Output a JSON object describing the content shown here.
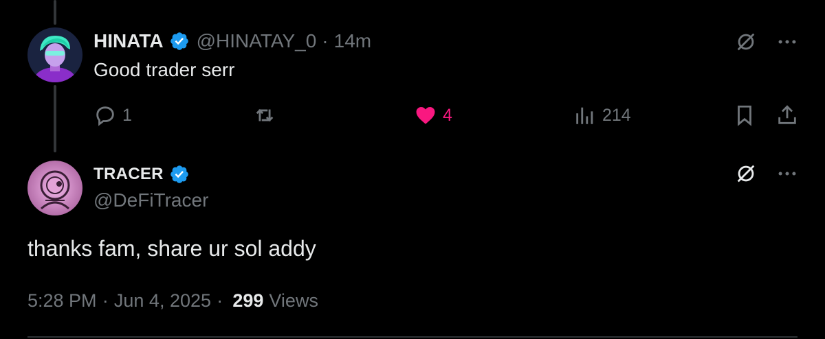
{
  "reply": {
    "author_name": "HINATA",
    "author_handle": "@HINATAY_0",
    "separator": "·",
    "time": "14m",
    "text": "Good trader serr",
    "replies": "1",
    "likes": "4",
    "views": "214",
    "liked": true,
    "like_color": "#f91880"
  },
  "main": {
    "author_name": "TRACER",
    "author_handle": "@DeFiTracer",
    "text": "thanks fam, share ur sol addy",
    "time": "5:28 PM",
    "separator": "·",
    "date": "Jun 4, 2025",
    "views_count": "299",
    "views_label": "Views"
  },
  "colors": {
    "background": "#000000",
    "text": "#e7e9ea",
    "muted": "#71767b",
    "verified": "#1d9bf0"
  },
  "icons": [
    "verified-badge-icon",
    "grok-icon",
    "more-icon",
    "reply-icon",
    "retweet-icon",
    "heart-icon",
    "views-icon",
    "bookmark-icon",
    "share-icon"
  ]
}
